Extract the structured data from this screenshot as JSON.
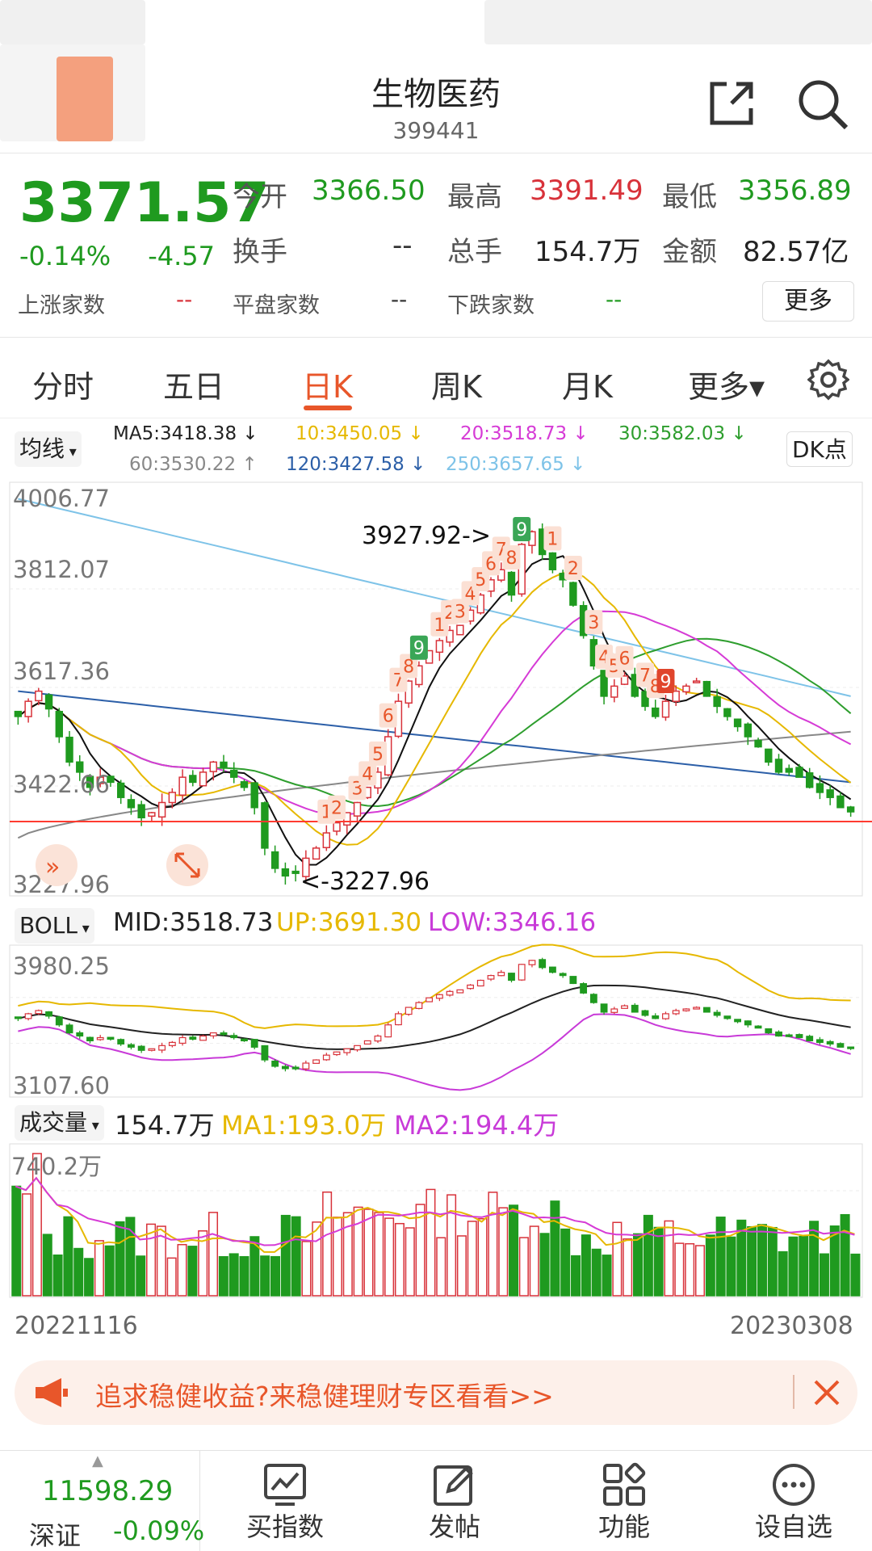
{
  "header": {
    "name": "生物医药",
    "code": "399441"
  },
  "quote": {
    "price": "3371.57",
    "change_pct": "-0.14%",
    "change": "-4.57",
    "open_label": "今开",
    "open": "3366.50",
    "high_label": "最高",
    "high": "3391.49",
    "low_label": "最低",
    "low": "3356.89",
    "turnover_label": "换手",
    "turnover": "--",
    "volume_label": "总手",
    "volume": "154.7万",
    "amount_label": "金额",
    "amount": "82.57亿",
    "up_label": "上涨家数",
    "up": "--",
    "flat_label": "平盘家数",
    "flat": "--",
    "down_label": "下跌家数",
    "down": "--",
    "more_label": "更多"
  },
  "tabs": [
    "分时",
    "五日",
    "日K",
    "周K",
    "月K",
    "更多▾"
  ],
  "active_tab": "日K",
  "ma_legend": {
    "selector": "均线",
    "ma5": "MA5:3418.38 ↓",
    "ma10": "10:3450.05 ↓",
    "ma20": "20:3518.73 ↓",
    "ma30": "30:3582.03 ↓",
    "ma60": "60:3530.22 ↑",
    "ma120": "120:3427.58 ↓",
    "ma250": "250:3657.65 ↓",
    "dk_button": "DK点"
  },
  "colors": {
    "up": "#d8323a",
    "down": "#1f9a1f",
    "ma5": "#111111",
    "ma10": "#e6b800",
    "ma20": "#d63bd6",
    "ma30": "#2e9e2e",
    "ma60": "#888888",
    "ma120": "#2c5fa8",
    "ma250": "#7ec3e8",
    "boll_up": "#e6b800",
    "boll_low": "#c83ad8"
  },
  "kline_chart": {
    "y_labels": [
      "4006.77",
      "3812.07",
      "3617.36",
      "3422.66",
      "3227.96"
    ],
    "high_annotation": "3927.92->",
    "low_annotation": "<-3227.96",
    "signal_numbers": [
      "1",
      "2",
      "3",
      "4",
      "5",
      "6",
      "7",
      "8",
      "9"
    ]
  },
  "boll": {
    "selector": "BOLL",
    "mid": "MID:3518.73",
    "up": "UP:3691.30",
    "low": "LOW:3346.16",
    "y_top": "3980.25",
    "y_bottom": "3107.60"
  },
  "volume_panel": {
    "selector": "成交量",
    "value": "154.7万",
    "ma1": "MA1:193.0万",
    "ma2": "MA2:194.4万",
    "y_top": "740.2万"
  },
  "dates": {
    "start": "20221116",
    "end": "20230308"
  },
  "banner": {
    "text": "追求稳健收益?来稳健理财专区看看>>"
  },
  "bottom_bar": {
    "index_value": "11598.29",
    "index_name": "深证",
    "index_change": "-0.09%",
    "items": [
      "买指数",
      "发帖",
      "功能",
      "设自选"
    ]
  },
  "chart_data": {
    "type": "candlestick",
    "x_start": "20221116",
    "x_end": "20230308",
    "ylim": [
      3227.96,
      4006.77
    ],
    "series": [
      {
        "name": "MA5",
        "last": 3418.38
      },
      {
        "name": "10",
        "last": 3450.05
      },
      {
        "name": "20",
        "last": 3518.73
      },
      {
        "name": "30",
        "last": 3582.03
      },
      {
        "name": "60",
        "last": 3530.22
      },
      {
        "name": "120",
        "last": 3427.58
      },
      {
        "name": "250",
        "last": 3657.65
      }
    ],
    "closes": [
      3560,
      3590,
      3610,
      3575,
      3520,
      3470,
      3450,
      3420,
      3440,
      3430,
      3400,
      3380,
      3360,
      3370,
      3390,
      3410,
      3440,
      3430,
      3450,
      3470,
      3460,
      3440,
      3420,
      3380,
      3300,
      3260,
      3245,
      3250,
      3280,
      3300,
      3330,
      3350,
      3370,
      3390,
      3420,
      3450,
      3520,
      3590,
      3630,
      3660,
      3690,
      3710,
      3730,
      3740,
      3770,
      3800,
      3830,
      3850,
      3800,
      3900,
      3925,
      3880,
      3850,
      3830,
      3780,
      3720,
      3660,
      3600,
      3620,
      3640,
      3600,
      3580,
      3560,
      3590,
      3610,
      3620,
      3630,
      3600,
      3580,
      3560,
      3540,
      3520,
      3500,
      3470,
      3450,
      3450,
      3440,
      3420,
      3410,
      3400,
      3380,
      3371.57
    ],
    "volume_ma1_last": "193.0万",
    "volume_ma2_last": "194.4万",
    "volume_last": "154.7万",
    "volume_max": "740.2万"
  }
}
